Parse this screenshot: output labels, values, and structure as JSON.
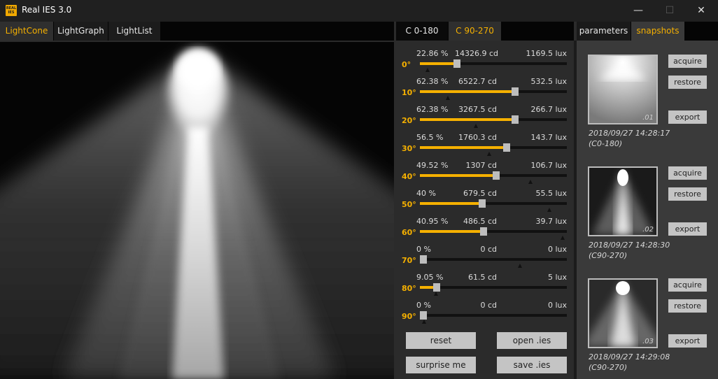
{
  "window": {
    "title": "Real IES 3.0",
    "icon_text_top": "REAL",
    "icon_text_bottom": "IES",
    "minimize": "—",
    "maximize": "☐",
    "close": "✕"
  },
  "view_tabs": [
    "LightCone",
    "LightGraph",
    "LightList"
  ],
  "c_tabs": [
    "C 0-180",
    "C 90-270"
  ],
  "side_tabs": [
    "parameters",
    "snapshots"
  ],
  "angles": [
    {
      "deg": "0°",
      "pct": "22.86 %",
      "cd": "14326.9 cd",
      "lux": "1169.5 lux",
      "value": 0.2286,
      "marker": 0.05
    },
    {
      "deg": "10°",
      "pct": "62.38 %",
      "cd": "6522.7 cd",
      "lux": "532.5 lux",
      "value": 0.6238,
      "marker": 0.19
    },
    {
      "deg": "20°",
      "pct": "62.38 %",
      "cd": "3267.5 cd",
      "lux": "266.7 lux",
      "value": 0.6238,
      "marker": 0.38
    },
    {
      "deg": "30°",
      "pct": "56.5 %",
      "cd": "1760.3 cd",
      "lux": "143.7 lux",
      "value": 0.565,
      "marker": 0.47
    },
    {
      "deg": "40°",
      "pct": "49.52 %",
      "cd": "1307 cd",
      "lux": "106.7 lux",
      "value": 0.4952,
      "marker": 0.75
    },
    {
      "deg": "50°",
      "pct": "40 %",
      "cd": "679.5 cd",
      "lux": "55.5 lux",
      "value": 0.4,
      "marker": 0.88
    },
    {
      "deg": "60°",
      "pct": "40.95 %",
      "cd": "486.5 cd",
      "lux": "39.7 lux",
      "value": 0.4095,
      "marker": 0.97
    },
    {
      "deg": "70°",
      "pct": "0 %",
      "cd": "0 cd",
      "lux": "0 lux",
      "value": 0.0,
      "marker": 0.68
    },
    {
      "deg": "80°",
      "pct": "9.05 %",
      "cd": "61.5 cd",
      "lux": "5 lux",
      "value": 0.0905,
      "marker": 0.11
    },
    {
      "deg": "90°",
      "pct": "0 %",
      "cd": "0 cd",
      "lux": "0 lux",
      "value": 0.0,
      "marker": 0.03
    }
  ],
  "buttons": {
    "reset": "reset",
    "open": "open .ies",
    "surprise": "surprise me",
    "save": "save .ies"
  },
  "snapshot_buttons": {
    "acquire": "acquire",
    "restore": "restore",
    "export": "export"
  },
  "snapshots": [
    {
      "num": ".01",
      "date": "2018/09/27 14:28:17",
      "range": "(C0-180)"
    },
    {
      "num": ".02",
      "date": "2018/09/27 14:28:30",
      "range": "(C90-270)"
    },
    {
      "num": ".03",
      "date": "2018/09/27 14:29:08",
      "range": "(C90-270)"
    }
  ],
  "colors": {
    "accent": "#f5b000",
    "panel": "#2b2b2b",
    "snapshot_panel": "#3a3a3a",
    "button": "#c4c4c4"
  }
}
